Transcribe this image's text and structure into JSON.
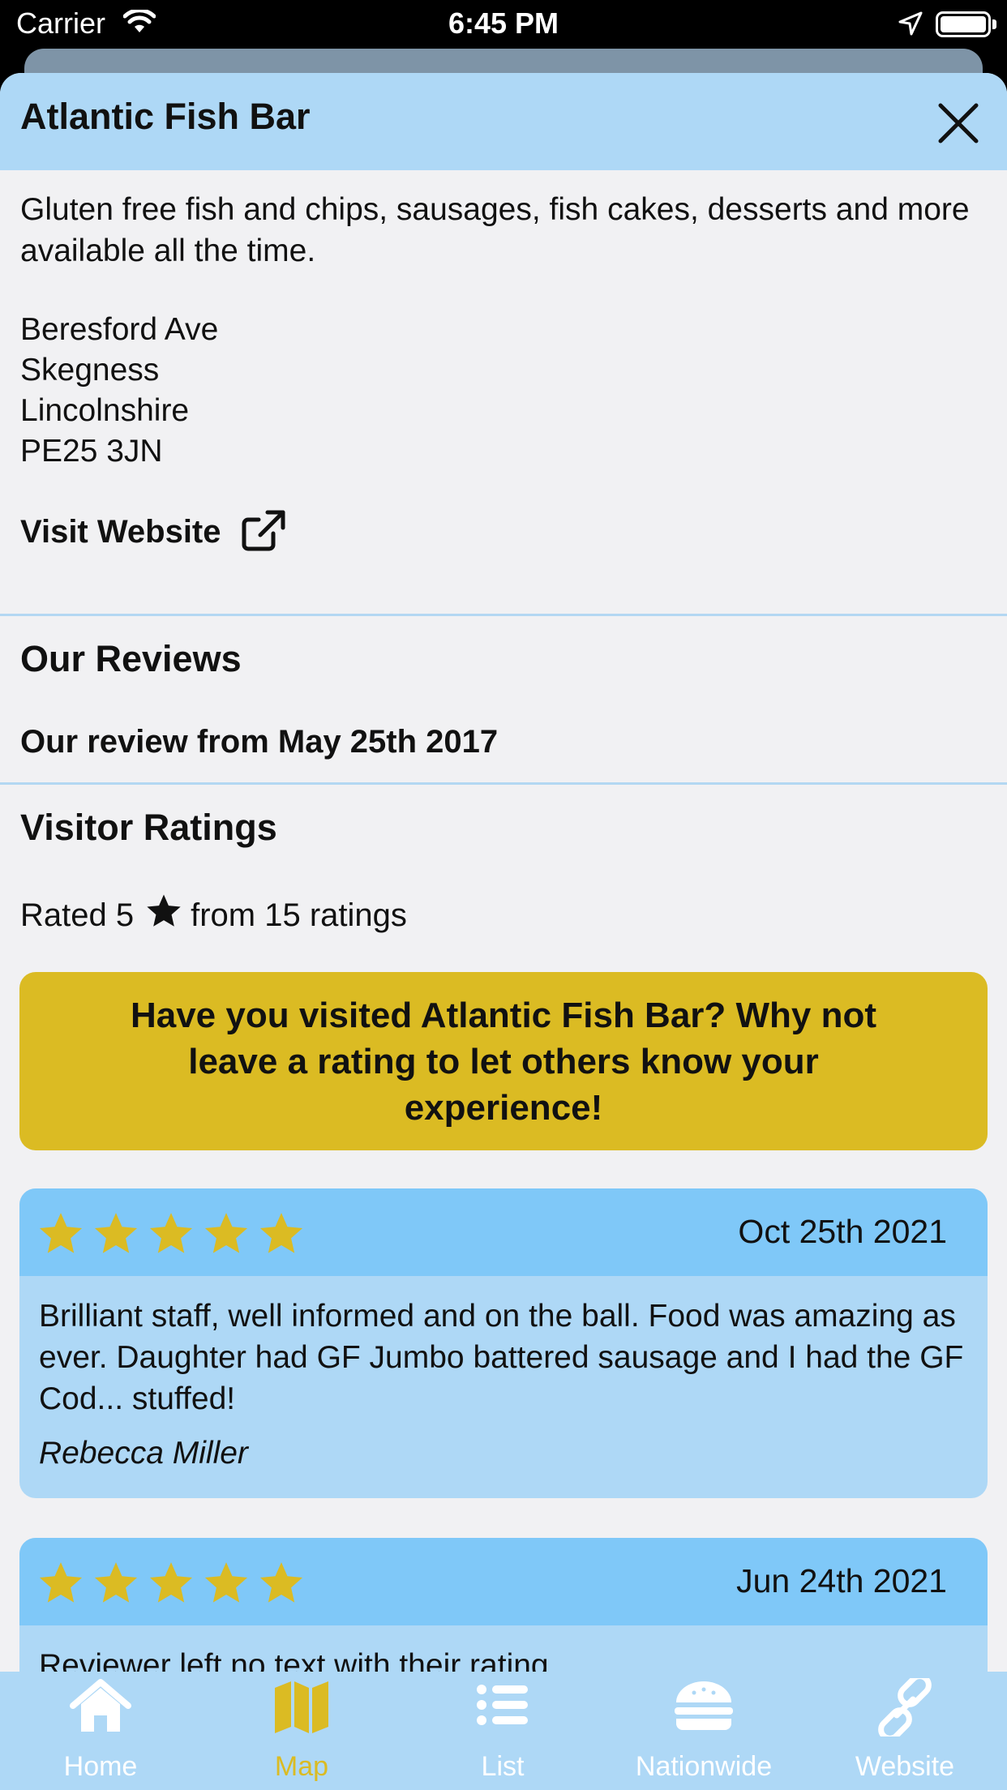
{
  "status_bar": {
    "carrier": "Carrier",
    "time": "6:45 PM"
  },
  "venue": {
    "name": "Atlantic Fish Bar",
    "description": "Gluten free fish and chips, sausages, fish cakes, desserts and more available all the time.",
    "address": [
      "Beresford Ave",
      "Skegness",
      "Lincolnshire",
      "PE25 3JN"
    ],
    "visit_website": "Visit Website"
  },
  "our_reviews": {
    "heading": "Our Reviews",
    "review_link": "Our review from May 25th 2017"
  },
  "visitor_ratings": {
    "heading": "Visitor Ratings",
    "rated_prefix": "Rated 5",
    "rated_suffix": "from 15 ratings",
    "rating_value": 5,
    "rating_count": 15,
    "cta": "Have you visited Atlantic Fish Bar? Why not leave a rating to let others know your experience!"
  },
  "reviews": [
    {
      "stars": 5,
      "date": "Oct 25th 2021",
      "text": "Brilliant staff, well informed and on the ball. Food was amazing as ever. Daughter had GF Jumbo battered sausage and I had the GF Cod... stuffed!",
      "author": "Rebecca Miller"
    },
    {
      "stars": 5,
      "date": "Jun 24th 2021",
      "text": "Reviewer left no text with their rating",
      "author": ""
    }
  ],
  "tabs": [
    {
      "label": "Home",
      "icon": "home-icon",
      "active": false
    },
    {
      "label": "Map",
      "icon": "map-icon",
      "active": true
    },
    {
      "label": "List",
      "icon": "list-icon",
      "active": false
    },
    {
      "label": "Nationwide",
      "icon": "burger-icon",
      "active": false
    },
    {
      "label": "Website",
      "icon": "link-icon",
      "active": false
    }
  ],
  "colors": {
    "header_bg": "#aed8f6",
    "card_head_bg": "#7fc8f8",
    "accent_gold": "#dbbb23",
    "background": "#f1f1f3"
  }
}
